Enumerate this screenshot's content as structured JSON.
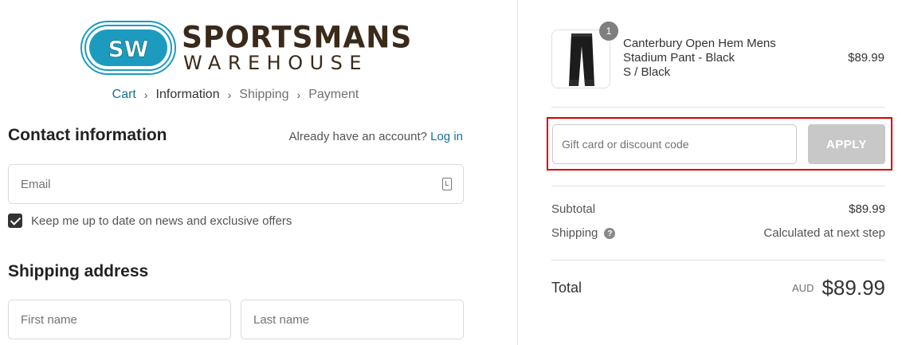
{
  "brand": {
    "logo_line1": "SPORTSMANS",
    "logo_line2": "WAREHOUSE",
    "badge_text": "SW",
    "colors": {
      "badge": "#1d9bbf",
      "text": "#3a2a1a",
      "link": "#1a6f97",
      "highlight": "#d80000"
    }
  },
  "breadcrumb": {
    "items": [
      "Cart",
      "Information",
      "Shipping",
      "Payment"
    ],
    "separator": "›"
  },
  "contact": {
    "title": "Contact information",
    "account_prompt": "Already have an account?",
    "login_label": "Log in",
    "email_placeholder": "Email",
    "newsletter_label": "Keep me up to date on news and exclusive offers",
    "newsletter_checked": true
  },
  "shipping_address": {
    "title": "Shipping address",
    "first_name_placeholder": "First name",
    "last_name_placeholder": "Last name"
  },
  "order": {
    "product": {
      "quantity": "1",
      "name": "Canterbury Open Hem Mens Stadium Pant - Black",
      "variant": "S / Black",
      "price": "$89.99"
    },
    "discount": {
      "placeholder": "Gift card or discount code",
      "apply_label": "APPLY"
    },
    "summary": {
      "subtotal_label": "Subtotal",
      "subtotal_value": "$89.99",
      "shipping_label": "Shipping",
      "shipping_value": "Calculated at next step",
      "help_glyph": "?"
    },
    "total": {
      "label": "Total",
      "currency": "AUD",
      "amount": "$89.99"
    }
  }
}
